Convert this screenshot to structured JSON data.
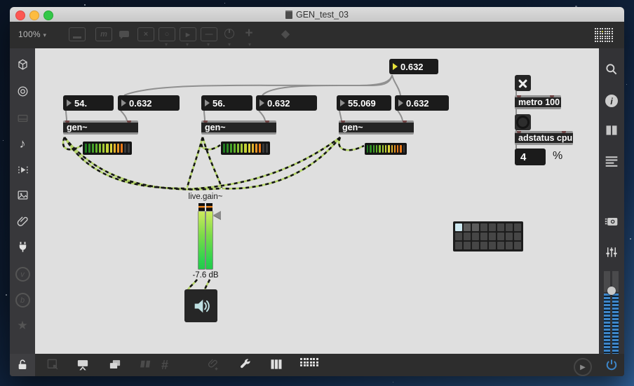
{
  "window": {
    "title": "GEN_test_03",
    "zoom_level": "100%",
    "zoom_caret": "▾"
  },
  "toolbar_top": {
    "icons": [
      "patcher-icon",
      "message-icon",
      "comment-icon",
      "toggle-icon",
      "button-icon",
      "playbar-icon",
      "object-icon",
      "dial-icon",
      "add-object-icon",
      "paint-icon",
      "grid-overlay-icon"
    ],
    "glyphs": {
      "message": "m",
      "toggle": "×",
      "button": "○",
      "playbar": "▶",
      "object": "—",
      "add": "+",
      "paint": "◆"
    }
  },
  "left_sidebar": {
    "icons": [
      "cube-icon",
      "target-icon",
      "console-icon",
      "audio-note-icon",
      "video-icon",
      "image-icon",
      "attachment-icon",
      "plug-icon",
      "vizzie-icon",
      "beap-icon",
      "favorites-icon"
    ],
    "glyphs": {
      "note": "♪",
      "vizzie": "v",
      "beap": "b",
      "star": "★"
    }
  },
  "right_sidebar": {
    "icons": [
      "search-icon",
      "inspector-info-icon",
      "reference-book-icon",
      "console-list-icon",
      "snapshot-camera-icon",
      "mixer-icon",
      "level-meter",
      "power-icon"
    ]
  },
  "bottom_toolbar": {
    "icons": [
      "lock-icon",
      "select-icon",
      "presentation-icon",
      "layers-icon",
      "align-icon",
      "grid-icon",
      "attach-add-icon",
      "wrench-icon",
      "piano-icon",
      "step-keyboard-icon",
      "play-circle-icon",
      "power-icon"
    ],
    "glyphs": {
      "grid": "#",
      "play": "▶"
    }
  },
  "patch": {
    "flonum_top": {
      "value": "0.632"
    },
    "groups": [
      {
        "freq": "54.",
        "amp": "0.632",
        "object": "gen~"
      },
      {
        "freq": "56.",
        "amp": "0.632",
        "object": "gen~"
      },
      {
        "freq": "55.069",
        "amp": "0.632",
        "object": "gen~"
      }
    ],
    "metro_label": "metro 100",
    "adstatus_label": "adstatus cpu",
    "cpu_value": "4",
    "cpu_unit": "%",
    "gain": {
      "label": "live.gain~",
      "db": "-7.6 dB"
    },
    "meter": {
      "segment_colors": [
        "#207a20",
        "#2e8c24",
        "#44a028",
        "#62b22c",
        "#84c032",
        "#a6cb36",
        "#c4d238",
        "#dcd43a",
        "#e2b22c",
        "#e69424",
        "#e87818",
        "#e87818",
        "#e87818"
      ],
      "unlit_color": "#3a3a3a",
      "segments": 13,
      "lit": [
        11,
        11,
        12
      ]
    },
    "matrix": {
      "cols": 8,
      "rows": 3,
      "active_cell": [
        0,
        0
      ],
      "active_color": "#cfe9f1",
      "soft_cells": [
        [
          0,
          1
        ],
        [
          0,
          2
        ]
      ],
      "soft_color": "#5c5c5c",
      "cell_color": "#464646"
    }
  },
  "grid_overlay_icon": {
    "cols": 8,
    "rows": 6,
    "dot_color": "#e4e4e4",
    "accent_color": "#d6d23a",
    "accent_index": 11
  },
  "step_keyboard_icon": {
    "cols": 6,
    "rows": 3,
    "color": "#d9d9d9"
  },
  "colors": {
    "accent_blue": "#3d86c9",
    "canvas": "#dfdfdf",
    "chrome": "#2d2d2d",
    "signal_cord": "#b5d46a",
    "message_cord": "#8f8f8f"
  }
}
